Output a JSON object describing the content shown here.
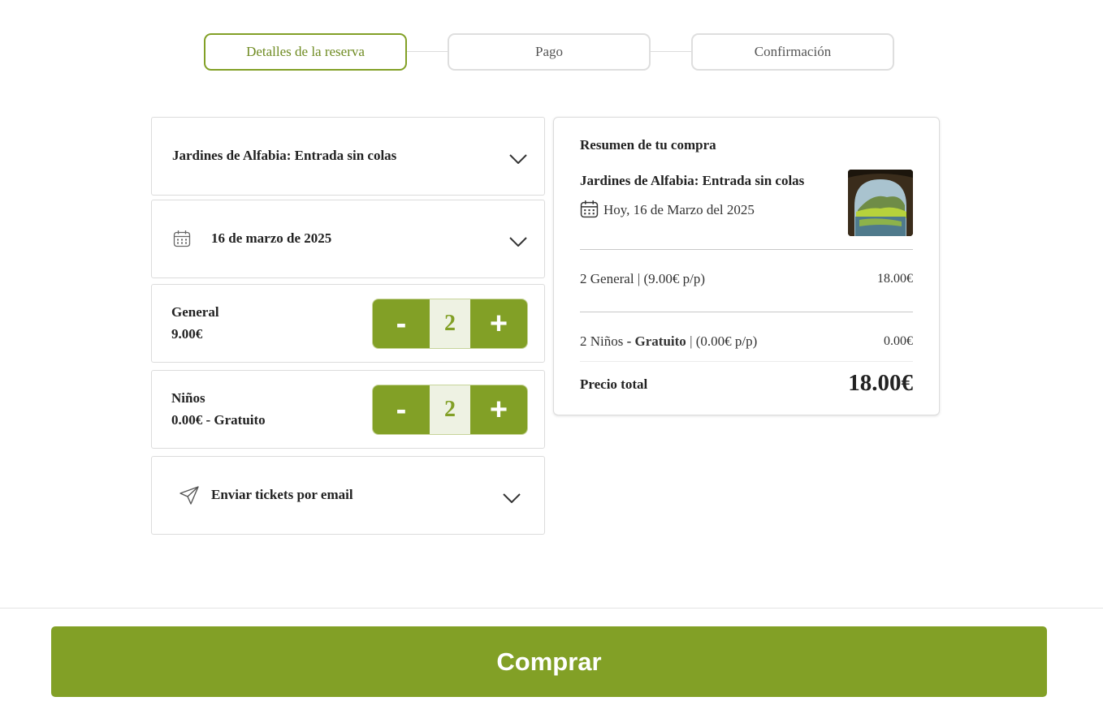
{
  "steps": [
    {
      "label": "Detalles de la reserva",
      "active": true
    },
    {
      "label": "Pago",
      "active": false
    },
    {
      "label": "Confirmación",
      "active": false
    }
  ],
  "booking": {
    "product_title": "Jardines de Alfabia: Entrada sin colas",
    "date_label": "16 de marzo de 2025",
    "tickets": [
      {
        "name": "General",
        "price": "9.00€",
        "minus": "-",
        "quantity": "2",
        "plus": "+"
      },
      {
        "name": "Niños",
        "price": "0.00€ - Gratuito",
        "minus": "-",
        "quantity": "2",
        "plus": "+"
      }
    ],
    "email_label": "Enviar tickets por email"
  },
  "summary": {
    "title": "Resumen de tu compra",
    "product": "Jardines de Alfabia: Entrada sin colas",
    "date": "Hoy, 16 de Marzo del 2025",
    "lines": [
      {
        "qty_name": "2 General",
        "sep": " | ",
        "detail": "(9.00€ p/p)",
        "amount": "18.00€"
      },
      {
        "qty_name": "2 Niños",
        "extra": " - Gratuito",
        "sep": " | ",
        "detail": "(0.00€ p/p)",
        "amount": "0.00€"
      }
    ],
    "total_label": "Precio total",
    "total_value": "18.00€"
  },
  "footer": {
    "buy_label": "Comprar"
  },
  "colors": {
    "accent": "#82a026",
    "accent_light": "#eef2e3",
    "border": "#dcdcdc"
  },
  "icons": [
    "chevron-down-icon",
    "calendar-icon",
    "send-icon",
    "product-thumbnail"
  ]
}
